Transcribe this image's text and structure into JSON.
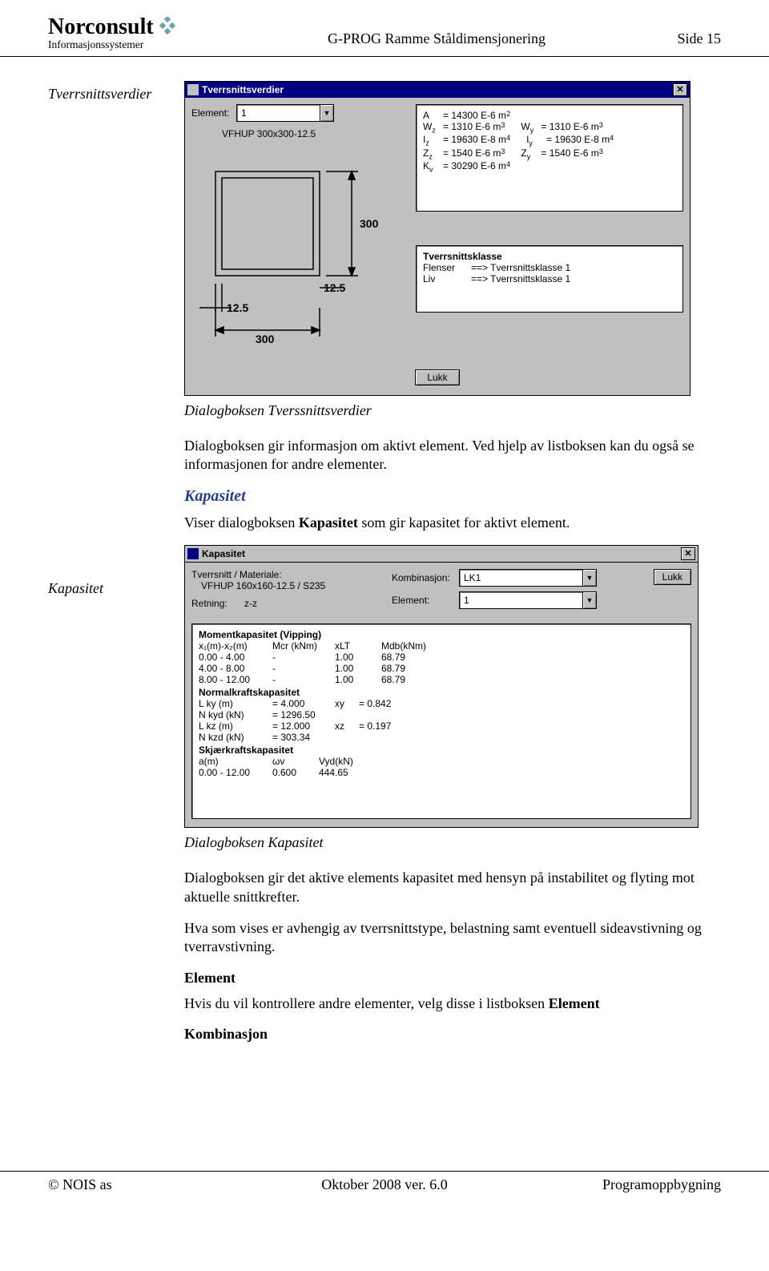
{
  "header": {
    "logo_name": "Norconsult",
    "logo_sub": "Informasjonssystemer",
    "center": "G-PROG Ramme Ståldimensjonering",
    "right": "Side 15"
  },
  "left_labels": {
    "tverrsnitt": "Tverrsnittsverdier",
    "kapasitet": "Kapasitet"
  },
  "dialog_tverrsnitt": {
    "title": "Tverrsnittsverdier",
    "element_label": "Element:",
    "element_value": "1",
    "profile": "VFHUP 300x300-12.5",
    "close_label": "Lukk",
    "dims": {
      "width": "300",
      "height": "300",
      "inner": "12.5",
      "t": "12.5"
    },
    "props": [
      {
        "l": "A",
        "v": "= 14300  E-6 m",
        "exp": "2"
      },
      {
        "l": "W",
        "sub": "z",
        "v": "=   1310  E-6 m",
        "exp": "3",
        "rl": "W",
        "rsub": "y",
        "rv": "=   1310  E-6 m",
        "rexp": "3"
      },
      {
        "l": "I",
        "sub": "z",
        "v": "= 19630  E-8 m",
        "exp": "4",
        "rl": "I",
        "rsub": "y",
        "rv": "= 19630  E-8 m",
        "rexp": "4"
      },
      {
        "l": "Z",
        "sub": "z",
        "v": "=   1540  E-6 m",
        "exp": "3",
        "rl": "Z",
        "rsub": "y",
        "rv": "=   1540  E-6 m",
        "rexp": "3"
      },
      {
        "l": "K",
        "sub": "v",
        "v": "= 30290  E-6 m",
        "exp": "4"
      }
    ],
    "klass": {
      "title": "Tverrsnittsklasse",
      "rows": [
        {
          "a": "Flenser",
          "b": "==> Tverrsnittsklasse 1"
        },
        {
          "a": "Liv",
          "b": "==> Tverrsnittsklasse 1"
        }
      ]
    }
  },
  "text1": {
    "caption": "Dialogboksen Tverssnittsverdier",
    "para1": "Dialogboksen gir informasjon om aktivt element. Ved hjelp av listboksen kan du også se informasjonen for andre elementer.",
    "hdr": "Kapasitet",
    "para2_a": "Viser dialogboksen ",
    "para2_b": "Kapasitet",
    "para2_c": " som gir kapasitet for aktivt element."
  },
  "dialog_kapasitet": {
    "title": "Kapasitet",
    "close": "Lukk",
    "tv_mat_label": "Tverrsnitt / Materiale:",
    "tv_mat_value": "VFHUP 160x160-12.5 / S235",
    "retning_label": "Retning:",
    "retning_value": "z-z",
    "komb_label": "Kombinasjon:",
    "komb_value": "LK1",
    "elem_label": "Element:",
    "elem_value": "1",
    "sections": {
      "moment": {
        "title": "Momentkapasitet (Vipping)",
        "headers": [
          "x₁(m)-x₂(m)",
          "Mcr (kNm)",
          "xLT",
          "Mdb(kNm)"
        ],
        "rows": [
          [
            "0.00 - 4.00",
            "-",
            "1.00",
            "68.79"
          ],
          [
            "4.00 - 8.00",
            "-",
            "1.00",
            "68.79"
          ],
          [
            "8.00 - 12.00",
            "-",
            "1.00",
            "68.79"
          ]
        ]
      },
      "normal": {
        "title": "Normalkraftskapasitet",
        "rows": [
          {
            "a": "L ky (m)",
            "b": "= 4.000",
            "c": "xy",
            "d": "= 0.842"
          },
          {
            "a": "N kyd (kN)",
            "b": "= 1296.50"
          },
          {
            "a": "L kz (m)",
            "b": "= 12.000",
            "c": "xz",
            "d": "= 0.197"
          },
          {
            "a": "N kzd (kN)",
            "b": "= 303.34"
          }
        ]
      },
      "skjaer": {
        "title": "Skjærkraftskapasitet",
        "headers": [
          "a(m)",
          "ωv",
          "Vyd(kN)"
        ],
        "rows": [
          [
            "0.00 - 12.00",
            "0.600",
            "444.65"
          ]
        ]
      }
    }
  },
  "text2": {
    "caption": "Dialogboksen Kapasitet",
    "p1": "Dialogboksen gir det aktive elements kapasitet med hensyn på instabilitet og flyting mot aktuelle snittkrefter.",
    "p2": "Hva som vises er avhengig av tverrsnittstype, belastning samt eventuell sideavstivning og tverravstivning.",
    "h_el": "Element",
    "p_el_a": "Hvis du vil kontrollere andre elementer, velg disse i listboksen ",
    "p_el_b": "Element",
    "h_komb": "Kombinasjon"
  },
  "footer": {
    "left": "© NOIS as",
    "center": "Oktober 2008 ver. 6.0",
    "right": "Programoppbygning"
  }
}
